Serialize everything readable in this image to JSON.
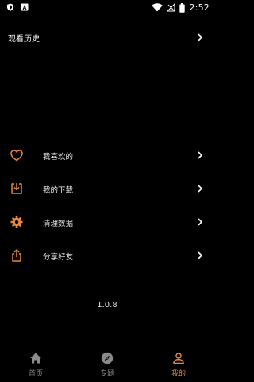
{
  "status_bar": {
    "time": "2:52"
  },
  "history": {
    "label": "观看历史"
  },
  "menu": [
    {
      "label": "我喜欢的",
      "icon": "heart-icon"
    },
    {
      "label": "我的下载",
      "icon": "download-icon"
    },
    {
      "label": "清理数据",
      "icon": "gear-icon"
    },
    {
      "label": "分享好友",
      "icon": "share-icon"
    }
  ],
  "version": {
    "text": "1.0.8"
  },
  "tabs": [
    {
      "label": "首页",
      "icon": "home-icon",
      "active": false
    },
    {
      "label": "专题",
      "icon": "compass-icon",
      "active": false
    },
    {
      "label": "我的",
      "icon": "person-icon",
      "active": true
    }
  ],
  "colors": {
    "accent": "#e88a3c",
    "background": "#000000",
    "inactive": "#8a8a8a"
  }
}
